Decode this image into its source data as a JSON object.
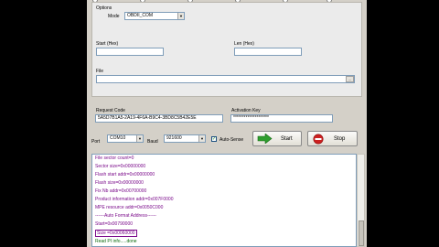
{
  "options": {
    "title": "Options",
    "mode_label": "Mode",
    "mode_value": "OBDII_COM"
  },
  "fields": {
    "start_label": "Start (Hex)",
    "start_value": "",
    "len_label": "Len (Hex)",
    "len_value": "",
    "file_label": "File",
    "file_value": "",
    "browse_label": "...",
    "request_label": "Request Code",
    "request_value": "5A5D7B1A5-2A19-4F6A-B9C4-3BD8C5B42E5E",
    "activation_label": "Activation Key",
    "activation_value": "********************"
  },
  "connection": {
    "port_label": "Port",
    "port_value": "COM10",
    "baud_label": "Baud",
    "baud_value": "921600",
    "autosense_label": "Auto-Sense",
    "autosense_checked": true
  },
  "buttons": {
    "start_label": "Start",
    "stop_label": "Stop"
  },
  "log": [
    {
      "text": "File sector count=0",
      "color": "#7a0a8a"
    },
    {
      "text": "Sector size=0x00000000",
      "color": "#7a0a8a"
    },
    {
      "text": "Flash start addr=0x00000000",
      "color": "#7a0a8a"
    },
    {
      "text": "Flash size=0x00000000",
      "color": "#7a0a8a"
    },
    {
      "text": "Fix Nb addr=0x00700000",
      "color": "#7a0a8a"
    },
    {
      "text": "Product information addr=0x007F0000",
      "color": "#7a0a8a"
    },
    {
      "text": "MPE resource addr=0x0050C000",
      "color": "#7a0a8a"
    },
    {
      "text": "------Auto Format Address------",
      "color": "#7a0a8a"
    },
    {
      "text": "Start=0x00790000",
      "color": "#7a0a8a"
    },
    {
      "text": "Size =0x00060000",
      "color": "#7a0a8a"
    },
    {
      "text": "Read PI info.....done",
      "color": "#0b6a0b"
    }
  ],
  "colors": {
    "window": "#d4d0c8",
    "accent_start": "#2e9e2e",
    "accent_stop": "#cc2020"
  },
  "icons": {
    "start": "arrow-right-icon",
    "stop": "no-entry-icon"
  }
}
